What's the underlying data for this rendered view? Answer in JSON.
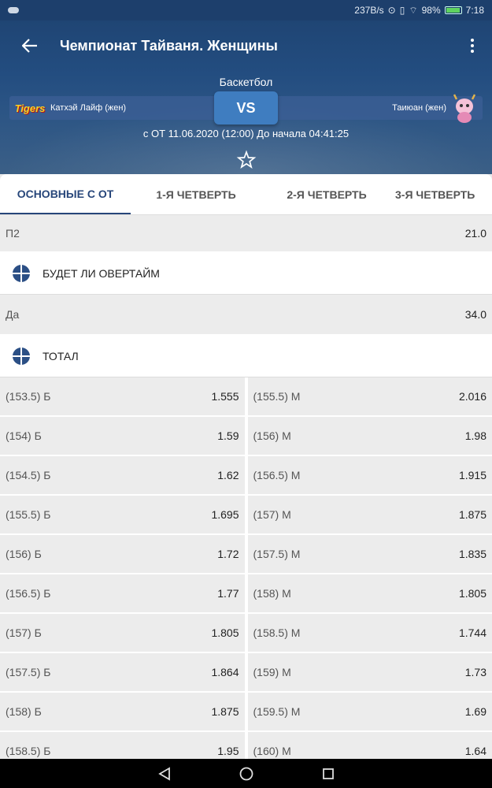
{
  "status_bar": {
    "speed": "237B/s",
    "battery": "98%",
    "time": "7:18"
  },
  "header": {
    "title": "Чемпионат Тайваня. Женщины",
    "sport": "Баскетбол",
    "team1": "Катхэй Лайф (жен)",
    "team1_logo_text": "Tigers",
    "team2": "Таиюан (жен)",
    "vs": "VS",
    "start_info": "с ОТ 11.06.2020 (12:00)  До начала 04:41:25"
  },
  "tabs": [
    {
      "label": "ОСНОВНЫЕ С ОТ"
    },
    {
      "label": "1-Я ЧЕТВЕРТЬ"
    },
    {
      "label": "2-Я ЧЕТВЕРТЬ"
    },
    {
      "label": "3-Я ЧЕТВЕРТЬ"
    }
  ],
  "rows": {
    "p2": {
      "label": "П2",
      "odd": "21.0"
    },
    "overtime_title": "БУДЕТ ЛИ ОВЕРТАЙМ",
    "overtime_yes": {
      "label": "Да",
      "odd": "34.0"
    },
    "total_title": "ТОТАЛ"
  },
  "totals": [
    {
      "over": "(153.5) Б",
      "over_odd": "1.555",
      "under": "(155.5) М",
      "under_odd": "2.016"
    },
    {
      "over": "(154) Б",
      "over_odd": "1.59",
      "under": "(156) М",
      "under_odd": "1.98"
    },
    {
      "over": "(154.5) Б",
      "over_odd": "1.62",
      "under": "(156.5) М",
      "under_odd": "1.915"
    },
    {
      "over": "(155.5) Б",
      "over_odd": "1.695",
      "under": "(157) М",
      "under_odd": "1.875"
    },
    {
      "over": "(156) Б",
      "over_odd": "1.72",
      "under": "(157.5) М",
      "under_odd": "1.835"
    },
    {
      "over": "(156.5) Б",
      "over_odd": "1.77",
      "under": "(158) М",
      "under_odd": "1.805"
    },
    {
      "over": "(157) Б",
      "over_odd": "1.805",
      "under": "(158.5) М",
      "under_odd": "1.744"
    },
    {
      "over": "(157.5) Б",
      "over_odd": "1.864",
      "under": "(159) М",
      "under_odd": "1.73"
    },
    {
      "over": "(158) Б",
      "over_odd": "1.875",
      "under": "(159.5) М",
      "under_odd": "1.69"
    },
    {
      "over": "(158.5) Б",
      "over_odd": "1.95",
      "under": "(160) М",
      "under_odd": "1.64"
    }
  ],
  "icons": {
    "back": "arrow-left-icon",
    "menu": "more-vert-icon",
    "favorite": "star-outline-icon",
    "section": "basketball-icon",
    "nav_back": "triangle-back-icon",
    "nav_home": "circle-home-icon",
    "nav_recent": "square-recent-icon"
  },
  "colors": {
    "header_bg": "#1f4574",
    "accent": "#27467a",
    "vs_button": "#3f7dc0"
  }
}
